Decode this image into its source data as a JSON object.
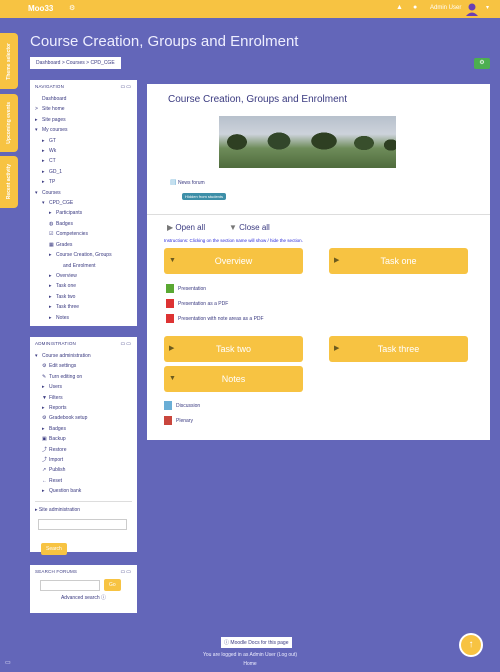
{
  "navbar": {
    "brand": "Moo33",
    "user_name": "Admin User"
  },
  "side_tabs": [
    "Theme selector",
    "Upcoming events",
    "Recent activity"
  ],
  "page_title": "Course Creation, Groups and Enrolment",
  "breadcrumb": "Dashboard > Courses > CPD_CGE",
  "navigation": {
    "title": "NAVIGATION",
    "items": [
      {
        "label": "Dashboard",
        "indent": 0,
        "icon": ""
      },
      {
        "label": "Site home",
        "indent": 0,
        "icon": ">"
      },
      {
        "label": "Site pages",
        "indent": 0,
        "icon": "▸"
      },
      {
        "label": "My courses",
        "indent": 0,
        "icon": "▾"
      },
      {
        "label": "GT",
        "indent": 1,
        "icon": "▸"
      },
      {
        "label": "Wk",
        "indent": 1,
        "icon": "▸"
      },
      {
        "label": "CT",
        "indent": 1,
        "icon": "▸"
      },
      {
        "label": "GD_1",
        "indent": 1,
        "icon": "▸"
      },
      {
        "label": "TP",
        "indent": 1,
        "icon": "▸"
      },
      {
        "label": "Courses",
        "indent": 0,
        "icon": "▾"
      },
      {
        "label": "CPD_CGE",
        "indent": 1,
        "icon": "▾"
      },
      {
        "label": "Participants",
        "indent": 2,
        "icon": "▸"
      },
      {
        "label": "Badges",
        "indent": 2,
        "icon": "◍"
      },
      {
        "label": "Competencies",
        "indent": 2,
        "icon": "☑"
      },
      {
        "label": "Grades",
        "indent": 2,
        "icon": "▦"
      },
      {
        "label": "Course Creation, Groups",
        "indent": 2,
        "icon": "▸"
      },
      {
        "label": "and Enrolment",
        "indent": 3,
        "icon": ""
      },
      {
        "label": "Overview",
        "indent": 2,
        "icon": "▸"
      },
      {
        "label": "Task one",
        "indent": 2,
        "icon": "▸"
      },
      {
        "label": "Task two",
        "indent": 2,
        "icon": "▸"
      },
      {
        "label": "Task three",
        "indent": 2,
        "icon": "▸"
      },
      {
        "label": "Notes",
        "indent": 2,
        "icon": "▸"
      }
    ]
  },
  "administration": {
    "title": "ADMINISTRATION",
    "items": [
      {
        "label": "Course administration",
        "indent": 0,
        "icon": "▾"
      },
      {
        "label": "Edit settings",
        "indent": 1,
        "icon": "⚙"
      },
      {
        "label": "Turn editing on",
        "indent": 1,
        "icon": "✎"
      },
      {
        "label": "Users",
        "indent": 1,
        "icon": "▸"
      },
      {
        "label": "Filters",
        "indent": 1,
        "icon": "▼"
      },
      {
        "label": "Reports",
        "indent": 1,
        "icon": "▸"
      },
      {
        "label": "Gradebook setup",
        "indent": 1,
        "icon": "⚙"
      },
      {
        "label": "Badges",
        "indent": 1,
        "icon": "▸"
      },
      {
        "label": "Backup",
        "indent": 1,
        "icon": "▣"
      },
      {
        "label": "Restore",
        "indent": 1,
        "icon": "⤴"
      },
      {
        "label": "Import",
        "indent": 1,
        "icon": "⤴"
      },
      {
        "label": "Publish",
        "indent": 1,
        "icon": "↗"
      },
      {
        "label": "Reset",
        "indent": 1,
        "icon": "←"
      },
      {
        "label": "Question bank",
        "indent": 1,
        "icon": "▸"
      }
    ],
    "site_admin": "Site administration",
    "search_button": "Search"
  },
  "search_forums": {
    "title": "SEARCH FORUMS",
    "go_button": "Go",
    "advanced": "Advanced search"
  },
  "main": {
    "course_title": "Course Creation, Groups and Enrolment",
    "forum": "News forum",
    "hidden_badge": "Hidden from students",
    "open_all": "Open all",
    "close_all": "Close all",
    "instructions": "Instructions: Clicking on the section name will show / hide the section.",
    "sections": {
      "overview": "Overview",
      "task_one": "Task one",
      "task_two": "Task two",
      "task_three": "Task three",
      "notes": "Notes"
    },
    "overview_activities": [
      "Presentation",
      "Presentation as a PDF",
      "Presentation with note areas as a PDF"
    ],
    "notes_activities": [
      "Discussion",
      "Plenary"
    ]
  },
  "footer": {
    "docs": "Moodle Docs for this page",
    "logged_in": "You are logged in as Admin User (Log out)",
    "home": "Home"
  },
  "colors": {
    "background": "#6366b9",
    "accent": "#f7c342",
    "text": "#3a3a80"
  }
}
